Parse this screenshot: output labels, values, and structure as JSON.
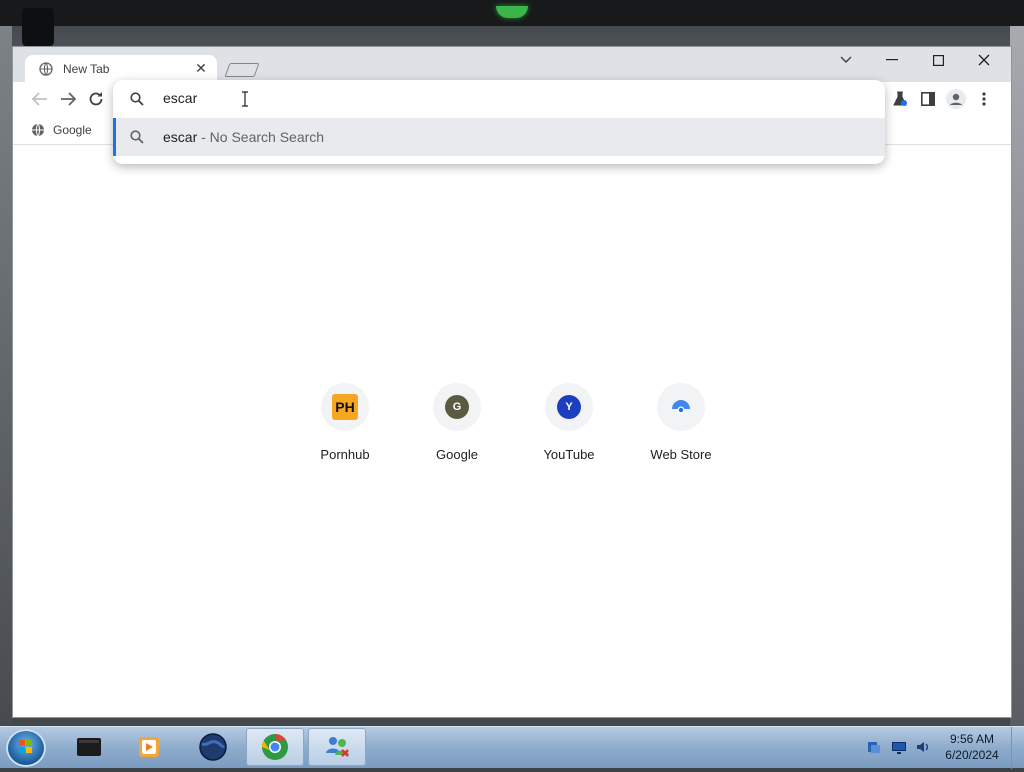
{
  "browser": {
    "tab": {
      "title": "New Tab",
      "close_glyph": "✕",
      "icon": "globe-icon"
    },
    "window_controls": {
      "dropdown": "⌄",
      "minimize": "—",
      "maximize": "☐",
      "close": "✕"
    },
    "bookmarks": [
      {
        "label": "Google",
        "icon": "globe-icon"
      }
    ],
    "omnibox": {
      "value": "escar",
      "suggestion_text": "escar",
      "suggestion_sub": " - No Search Search"
    }
  },
  "shortcuts": [
    {
      "label": "Pornhub",
      "icon_text": "PH"
    },
    {
      "label": "Google",
      "icon_text": "G"
    },
    {
      "label": "YouTube",
      "icon_text": "Y"
    },
    {
      "label": "Web Store",
      "icon": "webstore-icon"
    }
  ],
  "taskbar": {
    "clock_time": "9:56 AM",
    "clock_date": "6/20/2024"
  },
  "colors": {
    "accent": "#1a73e8",
    "pornhub_bg": "#f5a623",
    "google_avatar": "#5b5b3f",
    "youtube_avatar": "#1c3fbf"
  }
}
